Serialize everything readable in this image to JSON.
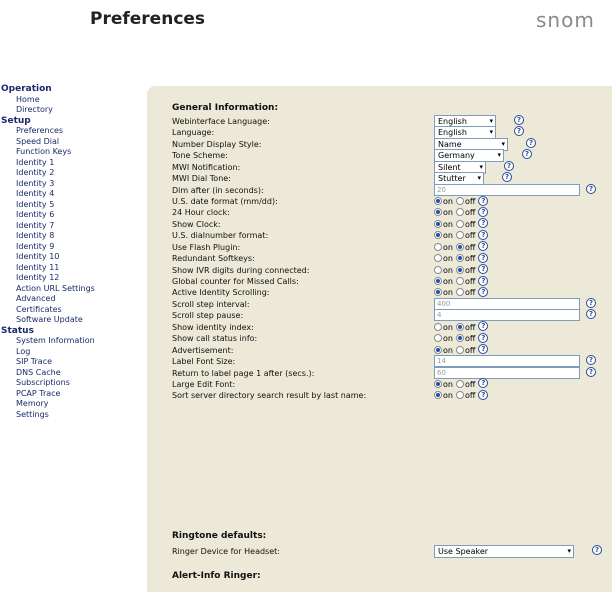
{
  "header": {
    "title": "Preferences",
    "logo_text": "snom"
  },
  "sidebar": {
    "groups": [
      {
        "label": "Operation",
        "items": [
          "Home",
          "Directory"
        ]
      },
      {
        "label": "Setup",
        "items": [
          "Preferences",
          "Speed Dial",
          "Function Keys",
          "Identity 1",
          "Identity 2",
          "Identity 3",
          "Identity 4",
          "Identity 5",
          "Identity 6",
          "Identity 7",
          "Identity 8",
          "Identity 9",
          "Identity 10",
          "Identity 11",
          "Identity 12",
          "Action URL Settings",
          "Advanced",
          "Certificates",
          "Software Update"
        ]
      },
      {
        "label": "Status",
        "items": [
          "System Information",
          "Log",
          "SIP Trace",
          "DNS Cache",
          "Subscriptions",
          "PCAP Trace",
          "Memory",
          "Settings"
        ]
      }
    ]
  },
  "radio_labels": {
    "on": "on",
    "off": "off"
  },
  "help_glyph": "?",
  "select_arrow": "▾",
  "sections": [
    {
      "title": "General Information:",
      "rows": [
        {
          "label": "Webinterface Language:",
          "type": "select",
          "value": "English"
        },
        {
          "label": "Language:",
          "type": "select",
          "value": "English"
        },
        {
          "label": "Number Display Style:",
          "type": "select",
          "value": "Name"
        },
        {
          "label": "Tone Scheme:",
          "type": "select",
          "value": "Germany"
        },
        {
          "label": "MWI Notification:",
          "type": "select",
          "value": "Silent"
        },
        {
          "label": "MWI Dial Tone:",
          "type": "select",
          "value": "Stutter"
        },
        {
          "label": "Dim after (in seconds):",
          "type": "text",
          "value": "20"
        },
        {
          "label": "U.S. date format (mm/dd):",
          "type": "radio",
          "value": "on"
        },
        {
          "label": "24 Hour clock:",
          "type": "radio",
          "value": "on"
        },
        {
          "label": "Show Clock:",
          "type": "radio",
          "value": "on"
        },
        {
          "label": "U.S. dialnumber format:",
          "type": "radio",
          "value": "on"
        },
        {
          "label": "Use Flash Plugin:",
          "type": "radio",
          "value": "off"
        },
        {
          "label": "Redundant Softkeys:",
          "type": "radio",
          "value": "off"
        },
        {
          "label": "Show IVR digits during connected:",
          "type": "radio",
          "value": "off"
        },
        {
          "label": "Global counter for Missed Calls:",
          "type": "radio",
          "value": "on"
        },
        {
          "label": "Active Identity Scrolling:",
          "type": "radio",
          "value": "on"
        },
        {
          "label": "Scroll step interval:",
          "type": "text",
          "value": "400"
        },
        {
          "label": "Scroll step pause:",
          "type": "text",
          "value": "4"
        },
        {
          "label": "Show identity index:",
          "type": "radio",
          "value": "off"
        },
        {
          "label": "Show call status info:",
          "type": "radio",
          "value": "off"
        },
        {
          "label": "Advertisement:",
          "type": "radio",
          "value": "on"
        },
        {
          "label": "Label Font Size:",
          "type": "text",
          "value": "14"
        },
        {
          "label": "Return to label page 1 after (secs.):",
          "type": "text",
          "value": "60"
        },
        {
          "label": "Large Edit Font:",
          "type": "radio",
          "value": "on"
        },
        {
          "label": "Sort server directory search result by last name:",
          "type": "radio",
          "value": "on"
        }
      ]
    },
    {
      "title": "Ringtone defaults:",
      "rows": [
        {
          "label": "Ringer Device for Headset:",
          "type": "select",
          "value": "Use Speaker"
        }
      ]
    },
    {
      "title": "Alert-Info Ringer:",
      "rows": []
    }
  ]
}
